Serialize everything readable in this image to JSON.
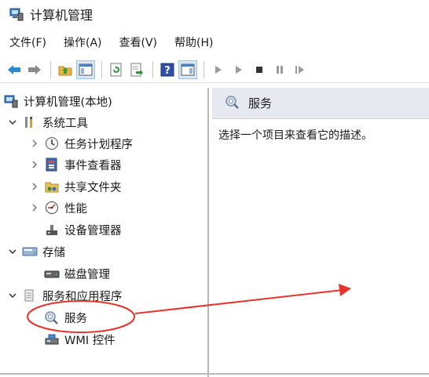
{
  "window": {
    "title": "计算机管理"
  },
  "menu": [
    {
      "label": "文件(F)"
    },
    {
      "label": "操作(A)"
    },
    {
      "label": "查看(V)"
    },
    {
      "label": "帮助(H)"
    }
  ],
  "tree": {
    "root": "计算机管理(本地)",
    "system_tools": "系统工具",
    "task_scheduler": "任务计划程序",
    "event_viewer": "事件查看器",
    "shared_folders": "共享文件夹",
    "performance": "性能",
    "device_manager": "设备管理器",
    "storage": "存储",
    "disk_management": "磁盘管理",
    "services_apps": "服务和应用程序",
    "services": "服务",
    "wmi": "WMI 控件"
  },
  "pane": {
    "header": "服务",
    "description": "选择一个项目来查看它的描述。"
  },
  "colors": {
    "annotation": "#e8332b",
    "header_bg": "#e6eaf0",
    "accent_blue": "#2a6fcf"
  }
}
